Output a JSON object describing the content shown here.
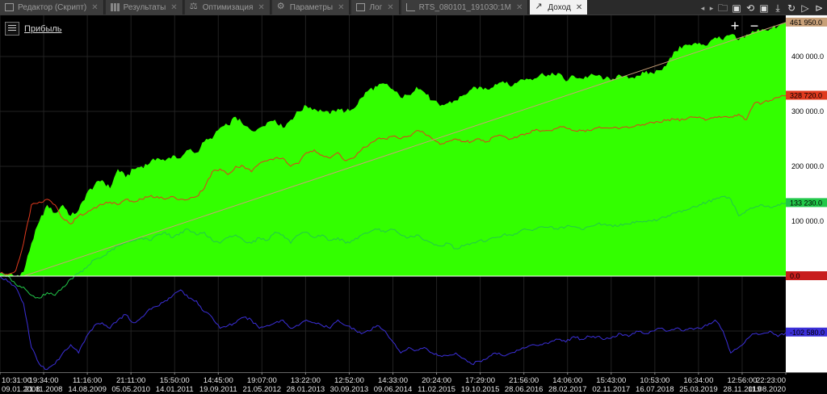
{
  "tabs": [
    {
      "label": "Редактор (Скрипт)",
      "icon": "document-icon",
      "active": false
    },
    {
      "label": "Результаты",
      "icon": "table-icon",
      "active": false
    },
    {
      "label": "Оптимизация",
      "icon": "balance-icon",
      "active": false
    },
    {
      "label": "Параметры",
      "icon": "gear-icon",
      "active": false
    },
    {
      "label": "Лог",
      "icon": "log-icon",
      "active": false
    },
    {
      "label": "RTS_080101_191030:1M",
      "icon": "chart-icon",
      "active": false
    },
    {
      "label": "Доход",
      "icon": "profit-icon",
      "active": true
    }
  ],
  "toolbar": {
    "icons": [
      "prev-icon",
      "next-icon",
      "open-folder-icon",
      "save-icon",
      "reload-icon",
      "save-icon",
      "download-icon",
      "refresh-icon",
      "play-icon",
      "step-icon"
    ]
  },
  "legend": {
    "label": "Прибыль"
  },
  "zoom": {
    "plus": "+",
    "minus": "−"
  },
  "colors": {
    "background": "#000000",
    "equity_fill": "#33ff00",
    "red_series": "#e03a1e",
    "green_series": "#22c84a",
    "blue_series": "#3b2fd8",
    "trend_line": "#c8a078",
    "zero_line": "#ffffff",
    "axis_panel": "#ffffff"
  },
  "chart_data": {
    "type": "area",
    "title": "Прибыль",
    "ylim": [
      -175000,
      475000
    ],
    "y_ticks": [
      {
        "value": 400000,
        "label": "400 000.0"
      },
      {
        "value": 300000,
        "label": "300 000.0"
      },
      {
        "value": 200000,
        "label": "200 000.0"
      },
      {
        "value": 100000,
        "label": "100 000.0"
      }
    ],
    "value_markers": [
      {
        "value": 461950,
        "label": "461 950.0",
        "color": "#c8a078"
      },
      {
        "value": 328720,
        "label": "328 720.0",
        "color": "#e03a1e"
      },
      {
        "value": 133230,
        "label": "133 230.0",
        "color": "#22c84a"
      },
      {
        "value": 0,
        "label": "0.0",
        "color": "#c81e1e"
      },
      {
        "value": -102580,
        "label": "-102 580.0",
        "color": "#3b2fd8"
      }
    ],
    "x_ticks": [
      {
        "time": "10:31:00",
        "date": "09.01.2008"
      },
      {
        "time": "19:34:00",
        "date": "21.11.2008"
      },
      {
        "time": "11:16:00",
        "date": "14.08.2009"
      },
      {
        "time": "21:11:00",
        "date": "05.05.2010"
      },
      {
        "time": "15:50:00",
        "date": "14.01.2011"
      },
      {
        "time": "14:45:00",
        "date": "19.09.2011"
      },
      {
        "time": "19:07:00",
        "date": "21.05.2012"
      },
      {
        "time": "13:22:00",
        "date": "28.01.2013"
      },
      {
        "time": "12:52:00",
        "date": "30.09.2013"
      },
      {
        "time": "14:33:00",
        "date": "09.06.2014"
      },
      {
        "time": "20:24:00",
        "date": "11.02.2015"
      },
      {
        "time": "17:29:00",
        "date": "19.10.2015"
      },
      {
        "time": "21:56:00",
        "date": "28.06.2016"
      },
      {
        "time": "14:06:00",
        "date": "28.02.2017"
      },
      {
        "time": "15:43:00",
        "date": "02.11.2017"
      },
      {
        "time": "10:53:00",
        "date": "16.07.2018"
      },
      {
        "time": "16:34:00",
        "date": "25.03.2019"
      },
      {
        "time": "12:56:00",
        "date": "28.11.2019"
      },
      {
        "time": "22:23:00",
        "date": "11.08.2020"
      }
    ],
    "series": [
      {
        "name": "",
        "kind": "area",
        "color": "#33ff00",
        "x": [
          0,
          0.01,
          0.02,
          0.03,
          0.04,
          0.05,
          0.06,
          0.07,
          0.08,
          0.09,
          0.1,
          0.11,
          0.12,
          0.13,
          0.14,
          0.15,
          0.16,
          0.17,
          0.18,
          0.19,
          0.2,
          0.21,
          0.22,
          0.23,
          0.24,
          0.25,
          0.26,
          0.27,
          0.28,
          0.29,
          0.3,
          0.31,
          0.32,
          0.33,
          0.34,
          0.35,
          0.36,
          0.37,
          0.38,
          0.39,
          0.4,
          0.41,
          0.42,
          0.43,
          0.44,
          0.45,
          0.46,
          0.47,
          0.48,
          0.49,
          0.5,
          0.51,
          0.52,
          0.53,
          0.54,
          0.55,
          0.56,
          0.57,
          0.58,
          0.59,
          0.6,
          0.61,
          0.62,
          0.63,
          0.64,
          0.65,
          0.66,
          0.67,
          0.68,
          0.69,
          0.7,
          0.71,
          0.72,
          0.73,
          0.74,
          0.75,
          0.76,
          0.77,
          0.78,
          0.79,
          0.8,
          0.81,
          0.82,
          0.83,
          0.84,
          0.85,
          0.86,
          0.87,
          0.88,
          0.89,
          0.9,
          0.91,
          0.92,
          0.93,
          0.94,
          0.95,
          0.96,
          0.97,
          0.98,
          0.99,
          1
        ],
        "values": [
          5000,
          3000,
          0,
          8000,
          60000,
          100000,
          130000,
          115000,
          130000,
          110000,
          120000,
          150000,
          165000,
          175000,
          160000,
          195000,
          180000,
          195000,
          200000,
          205000,
          215000,
          210000,
          220000,
          215000,
          230000,
          225000,
          245000,
          250000,
          270000,
          275000,
          290000,
          275000,
          265000,
          270000,
          280000,
          285000,
          270000,
          285000,
          300000,
          310000,
          305000,
          300000,
          295000,
          305000,
          300000,
          305000,
          325000,
          340000,
          345000,
          350000,
          340000,
          325000,
          330000,
          345000,
          335000,
          320000,
          310000,
          315000,
          320000,
          330000,
          340000,
          345000,
          340000,
          350000,
          355000,
          345000,
          355000,
          360000,
          360000,
          370000,
          365000,
          370000,
          355000,
          365000,
          360000,
          365000,
          365000,
          360000,
          360000,
          365000,
          360000,
          365000,
          370000,
          370000,
          375000,
          390000,
          410000,
          420000,
          420000,
          425000,
          420000,
          435000,
          430000,
          440000,
          430000,
          440000,
          445000,
          450000,
          450000,
          455000,
          462000
        ]
      },
      {
        "name": "",
        "kind": "line",
        "color": "#e03a1e",
        "x": [
          0,
          0.01,
          0.02,
          0.03,
          0.04,
          0.05,
          0.06,
          0.07,
          0.08,
          0.09,
          0.1,
          0.11,
          0.12,
          0.13,
          0.14,
          0.15,
          0.16,
          0.17,
          0.18,
          0.19,
          0.2,
          0.21,
          0.22,
          0.23,
          0.24,
          0.25,
          0.26,
          0.27,
          0.28,
          0.29,
          0.3,
          0.31,
          0.32,
          0.33,
          0.34,
          0.35,
          0.36,
          0.37,
          0.38,
          0.39,
          0.4,
          0.41,
          0.42,
          0.43,
          0.44,
          0.45,
          0.46,
          0.47,
          0.48,
          0.49,
          0.5,
          0.51,
          0.52,
          0.53,
          0.54,
          0.55,
          0.56,
          0.57,
          0.58,
          0.59,
          0.6,
          0.61,
          0.62,
          0.63,
          0.64,
          0.65,
          0.66,
          0.67,
          0.68,
          0.69,
          0.7,
          0.71,
          0.72,
          0.73,
          0.74,
          0.75,
          0.76,
          0.77,
          0.78,
          0.79,
          0.8,
          0.81,
          0.82,
          0.83,
          0.84,
          0.85,
          0.86,
          0.87,
          0.88,
          0.89,
          0.9,
          0.91,
          0.92,
          0.93,
          0.94,
          0.95,
          0.96,
          0.97,
          0.98,
          0.99,
          1
        ],
        "values": [
          5000,
          3000,
          10000,
          60000,
          130000,
          135000,
          140000,
          130000,
          105000,
          95000,
          110000,
          115000,
          125000,
          130000,
          135000,
          130000,
          140000,
          135000,
          140000,
          145000,
          145000,
          140000,
          145000,
          140000,
          140000,
          145000,
          160000,
          190000,
          195000,
          185000,
          200000,
          200000,
          190000,
          205000,
          210000,
          215000,
          215000,
          200000,
          205000,
          225000,
          230000,
          220000,
          215000,
          225000,
          210000,
          215000,
          230000,
          240000,
          250000,
          250000,
          255000,
          250000,
          255000,
          265000,
          260000,
          250000,
          240000,
          245000,
          250000,
          245000,
          245000,
          250000,
          245000,
          255000,
          255000,
          250000,
          255000,
          260000,
          265000,
          265000,
          265000,
          270000,
          270000,
          265000,
          265000,
          265000,
          270000,
          270000,
          270000,
          270000,
          270000,
          275000,
          275000,
          280000,
          280000,
          285000,
          285000,
          285000,
          290000,
          290000,
          285000,
          290000,
          290000,
          290000,
          295000,
          285000,
          315000,
          315000,
          320000,
          325000,
          328720
        ]
      },
      {
        "name": "",
        "kind": "line",
        "color": "#22c84a",
        "x": [
          0,
          0.01,
          0.02,
          0.03,
          0.04,
          0.05,
          0.06,
          0.07,
          0.08,
          0.09,
          0.1,
          0.11,
          0.12,
          0.13,
          0.14,
          0.15,
          0.16,
          0.17,
          0.18,
          0.19,
          0.2,
          0.21,
          0.22,
          0.23,
          0.24,
          0.25,
          0.26,
          0.27,
          0.28,
          0.29,
          0.3,
          0.31,
          0.32,
          0.33,
          0.34,
          0.35,
          0.36,
          0.37,
          0.38,
          0.39,
          0.4,
          0.41,
          0.42,
          0.43,
          0.44,
          0.45,
          0.46,
          0.47,
          0.48,
          0.49,
          0.5,
          0.51,
          0.52,
          0.53,
          0.54,
          0.55,
          0.56,
          0.57,
          0.58,
          0.59,
          0.6,
          0.61,
          0.62,
          0.63,
          0.64,
          0.65,
          0.66,
          0.67,
          0.68,
          0.69,
          0.7,
          0.71,
          0.72,
          0.73,
          0.74,
          0.75,
          0.76,
          0.77,
          0.78,
          0.79,
          0.8,
          0.81,
          0.82,
          0.83,
          0.84,
          0.85,
          0.86,
          0.87,
          0.88,
          0.89,
          0.9,
          0.91,
          0.92,
          0.93,
          0.94,
          0.95,
          0.96,
          0.97,
          0.98,
          0.99,
          1
        ],
        "values": [
          5000,
          0,
          -15000,
          -20000,
          -35000,
          -40000,
          -30000,
          -35000,
          -20000,
          -5000,
          5000,
          15000,
          30000,
          35000,
          45000,
          55000,
          60000,
          65000,
          70000,
          65000,
          75000,
          80000,
          70000,
          80000,
          85000,
          75000,
          80000,
          65000,
          60000,
          70000,
          75000,
          65000,
          60000,
          70000,
          65000,
          80000,
          75000,
          60000,
          75000,
          80000,
          70000,
          75000,
          65000,
          70000,
          60000,
          65000,
          75000,
          80000,
          85000,
          80000,
          85000,
          75000,
          70000,
          75000,
          65000,
          60000,
          55000,
          60000,
          50000,
          55000,
          60000,
          65000,
          65000,
          70000,
          75000,
          75000,
          80000,
          85000,
          85000,
          90000,
          90000,
          85000,
          90000,
          90000,
          85000,
          90000,
          95000,
          95000,
          90000,
          95000,
          95000,
          100000,
          100000,
          100000,
          105000,
          110000,
          115000,
          120000,
          125000,
          130000,
          135000,
          140000,
          145000,
          140000,
          110000,
          120000,
          125000,
          130000,
          125000,
          130000,
          133230
        ]
      },
      {
        "name": "",
        "kind": "line",
        "color": "#3b2fd8",
        "x": [
          0,
          0.01,
          0.02,
          0.03,
          0.04,
          0.05,
          0.06,
          0.07,
          0.08,
          0.09,
          0.1,
          0.11,
          0.12,
          0.13,
          0.14,
          0.15,
          0.16,
          0.17,
          0.18,
          0.19,
          0.2,
          0.21,
          0.22,
          0.23,
          0.24,
          0.25,
          0.26,
          0.27,
          0.28,
          0.29,
          0.3,
          0.31,
          0.32,
          0.33,
          0.34,
          0.35,
          0.36,
          0.37,
          0.38,
          0.39,
          0.4,
          0.41,
          0.42,
          0.43,
          0.44,
          0.45,
          0.46,
          0.47,
          0.48,
          0.49,
          0.5,
          0.51,
          0.52,
          0.53,
          0.54,
          0.55,
          0.56,
          0.57,
          0.58,
          0.59,
          0.6,
          0.61,
          0.62,
          0.63,
          0.64,
          0.65,
          0.66,
          0.67,
          0.68,
          0.69,
          0.7,
          0.71,
          0.72,
          0.73,
          0.74,
          0.75,
          0.76,
          0.77,
          0.78,
          0.79,
          0.8,
          0.81,
          0.82,
          0.83,
          0.84,
          0.85,
          0.86,
          0.87,
          0.88,
          0.89,
          0.9,
          0.91,
          0.92,
          0.93,
          0.94,
          0.95,
          0.96,
          0.97,
          0.98,
          0.99,
          1
        ],
        "values": [
          0,
          -10000,
          -20000,
          -50000,
          -130000,
          -160000,
          -170000,
          -160000,
          -140000,
          -125000,
          -140000,
          -110000,
          -90000,
          -85000,
          -95000,
          -80000,
          -70000,
          -85000,
          -75000,
          -60000,
          -55000,
          -45000,
          -35000,
          -25000,
          -40000,
          -45000,
          -65000,
          -75000,
          -95000,
          -90000,
          -85000,
          -75000,
          -80000,
          -95000,
          -90000,
          -85000,
          -80000,
          -95000,
          -90000,
          -80000,
          -85000,
          -90000,
          -95000,
          -80000,
          -90000,
          -95000,
          -105000,
          -100000,
          -90000,
          -100000,
          -120000,
          -140000,
          -130000,
          -135000,
          -130000,
          -140000,
          -145000,
          -145000,
          -140000,
          -150000,
          -160000,
          -155000,
          -150000,
          -140000,
          -145000,
          -140000,
          -135000,
          -130000,
          -125000,
          -125000,
          -120000,
          -115000,
          -120000,
          -110000,
          -115000,
          -110000,
          -110000,
          -115000,
          -110000,
          -105000,
          -110000,
          -100000,
          -105000,
          -100000,
          -95000,
          -100000,
          -95000,
          -100000,
          -95000,
          -95000,
          -90000,
          -80000,
          -100000,
          -140000,
          -130000,
          -115000,
          -105000,
          -105000,
          -100000,
          -110000,
          -102580
        ]
      },
      {
        "name": "",
        "kind": "trend",
        "color": "#c8a078",
        "x": [
          0.03,
          1
        ],
        "values": [
          0,
          461950
        ]
      }
    ]
  }
}
